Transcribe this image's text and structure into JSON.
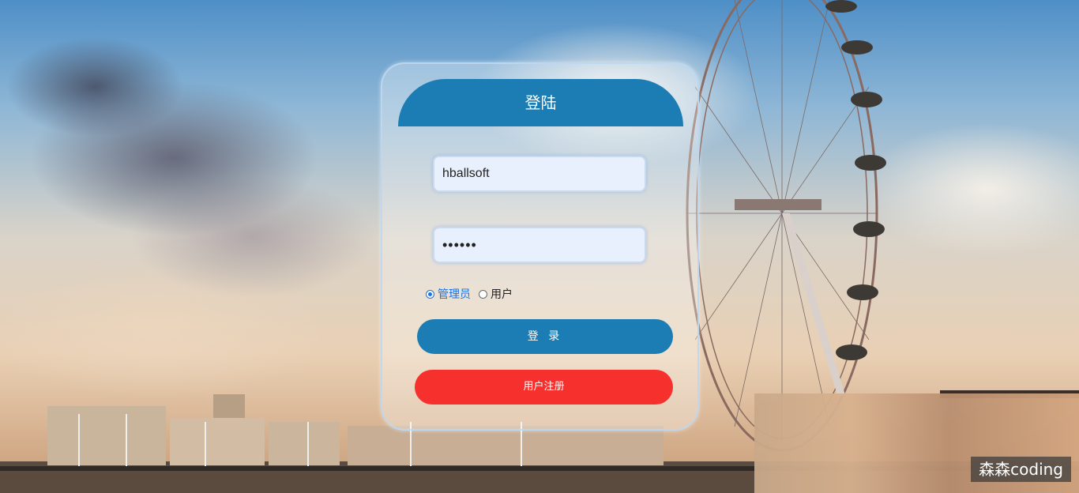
{
  "login": {
    "title": "登陆",
    "username_value": "hballsoft",
    "password_value": "••••••",
    "roles": [
      {
        "label": "管理员",
        "checked": true
      },
      {
        "label": "用户",
        "checked": false
      }
    ],
    "login_button": "登 录",
    "register_button": "用户注册"
  },
  "watermark": "森森coding",
  "colors": {
    "header": "#1b7db3",
    "login_button": "#1b7db3",
    "register_button": "#f5302d",
    "input_bg": "#e8f0fe"
  }
}
